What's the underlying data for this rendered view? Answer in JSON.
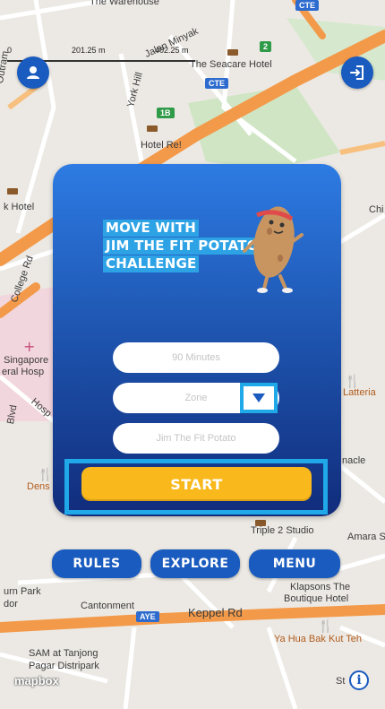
{
  "map": {
    "labels": {
      "warehouse": "The Warehouse",
      "seacare": "The Seacare Hotel",
      "outram": "Outram",
      "york_hill": "York Hill",
      "jalan_minyak": "Jalan Minyak",
      "hotel_re": "Hotel Re!",
      "k_hotel": "k Hotel",
      "chi": "Chi",
      "college_rd": "College Rd",
      "singapore": "Singapore",
      "eral_hosp": "eral Hosp",
      "blvd": "Blvd",
      "hosp": "Hosp",
      "latteria": "Latteria",
      "nacle": "nacle",
      "dens": "Dens",
      "triple2": "Triple 2 Studio",
      "amara": "Amara S",
      "urn_park": "urn Park",
      "dor": "dor",
      "cantonment": "Cantonment",
      "keppel": "Keppel Rd",
      "klapsons": "Klapsons The",
      "boutique": "Boutique Hotel",
      "ya_hua": "Ya Hua Bak Kut Teh",
      "sam": "SAM at Tanjong",
      "pagar": "Pagar Distripark",
      "st": "St"
    },
    "road_tags": {
      "cte_top": "CTE",
      "cte_mid": "CTE",
      "r1b": "1B",
      "r2": "2",
      "aye": "AYE"
    },
    "scale": {
      "left": "0",
      "mid": "201.25 m",
      "right": "402.25 m"
    },
    "attribution": "mapbox"
  },
  "top_bar": {
    "left_icon": "profile-icon",
    "right_icon": "logout-icon"
  },
  "challenge_card": {
    "title_lines": [
      "MOVE WITH",
      "JIM THE FIT POTATO",
      "CHALLENGE"
    ],
    "mascot": "potato-mascot",
    "duration_placeholder": "90 Minutes",
    "zone_placeholder": "Zone",
    "challenge_placeholder": "Jim The Fit Potato",
    "start_label": "START"
  },
  "bottom_nav": {
    "rules": "RULES",
    "explore": "EXPLORE",
    "menu": "MENU"
  },
  "colors": {
    "primary_blue": "#1a5bbf",
    "highlight_cyan": "#1fa9e8",
    "start_yellow": "#f9b81b",
    "road_orange": "#f39a4a"
  }
}
